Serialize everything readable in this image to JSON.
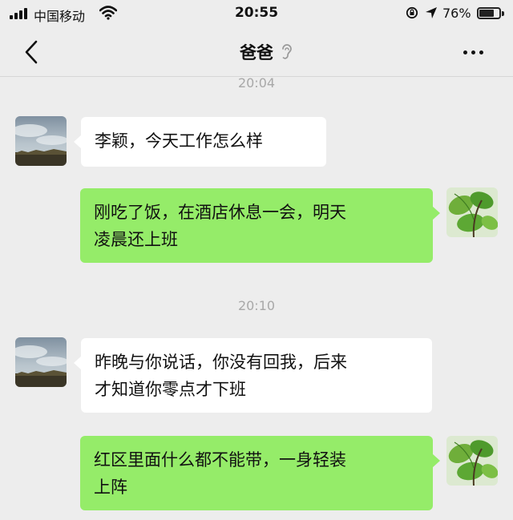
{
  "status_bar": {
    "carrier": "中国移动",
    "time": "20:55",
    "battery_percent": "76%",
    "battery_level": 0.76,
    "icons": [
      "signal-icon",
      "wifi-icon",
      "rotation-lock-icon",
      "location-icon",
      "battery-icon"
    ]
  },
  "nav": {
    "title": "爸爸",
    "icons": [
      "back-arrow-icon",
      "earpiece-mode-icon",
      "more-icon"
    ]
  },
  "chat": {
    "messages": [
      {
        "type": "timestamp",
        "text": "20:04"
      },
      {
        "type": "received",
        "lines": [
          "李颖，今天工作怎么样"
        ]
      },
      {
        "type": "sent",
        "lines": [
          "刚吃了饭，在酒店休息一会，明天",
          "凌晨还上班"
        ]
      },
      {
        "type": "timestamp",
        "text": "20:10"
      },
      {
        "type": "received",
        "lines": [
          "昨晚与你说话，你没有回我，后来",
          "才知道你零点才下班"
        ]
      },
      {
        "type": "sent",
        "lines": [
          "红区里面什么都不能带，一身轻装",
          "上阵"
        ]
      }
    ]
  },
  "colors": {
    "background": "#ededed",
    "sent_bubble": "#95ec69",
    "received_bubble": "#ffffff",
    "timestamp": "#a8a8a8"
  }
}
